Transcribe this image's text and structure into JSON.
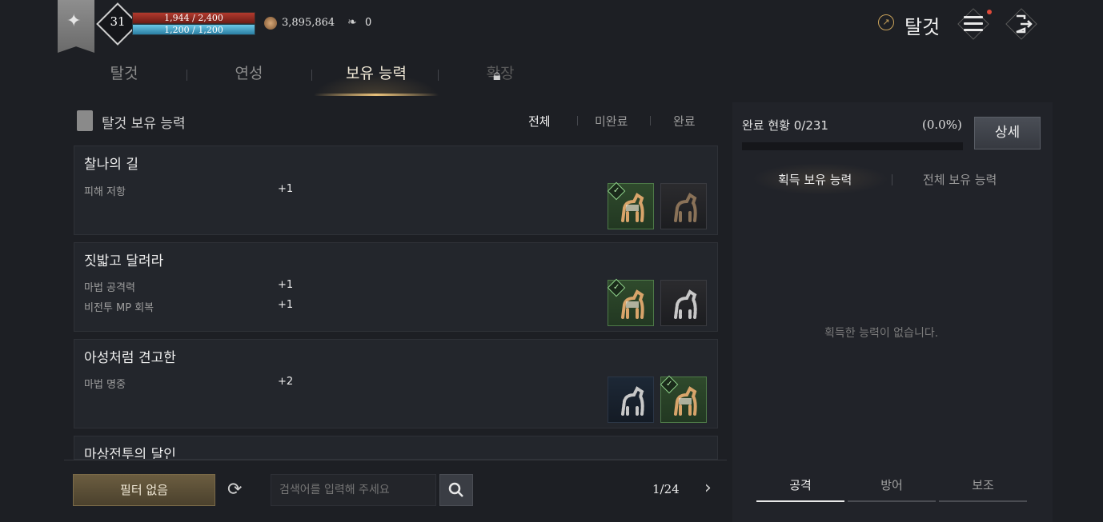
{
  "player": {
    "level": "31",
    "hp": "1,944 / 2,400",
    "hp_fraction": 0.81,
    "mp": "1,200 / 1,200",
    "mp_fraction": 1.0,
    "gold": "3,895,864",
    "wings": "0"
  },
  "header": {
    "title": "탈것",
    "title_icon": "external-link-icon",
    "menu_icon": "hamburger-menu-icon",
    "exit_icon": "exit-icon"
  },
  "tabs": [
    {
      "label": "탈것",
      "active": false
    },
    {
      "label": "연성",
      "active": false
    },
    {
      "label": "보유 능력",
      "active": true
    },
    {
      "label": "확장",
      "active": false,
      "locked": true
    }
  ],
  "section": {
    "title": "탈것 보유 능력",
    "filters": [
      "전체",
      "미완료",
      "완료"
    ],
    "active_filter": "전체"
  },
  "cards": [
    {
      "title": "찰나의 길",
      "stats": [
        {
          "name": "피해 저항",
          "value": "+1"
        }
      ],
      "mounts": [
        {
          "style": "green",
          "owned": true,
          "icon": "tan-horse-icon"
        },
        {
          "style": "dark",
          "owned": false,
          "icon": "brown-horse-icon"
        }
      ]
    },
    {
      "title": "짓밟고 달려라",
      "stats": [
        {
          "name": "마법 공격력",
          "value": "+1"
        },
        {
          "name": "비전투 MP 회복",
          "value": "+1"
        }
      ],
      "mounts": [
        {
          "style": "green",
          "owned": true,
          "icon": "tan-horse-icon"
        },
        {
          "style": "dark",
          "owned": false,
          "icon": "zebra-icon"
        }
      ]
    },
    {
      "title": "아성처럼 견고한",
      "stats": [
        {
          "name": "마법 명중",
          "value": "+2"
        }
      ],
      "mounts": [
        {
          "style": "navy",
          "owned": false,
          "icon": "zebra-icon"
        },
        {
          "style": "green",
          "owned": true,
          "icon": "tan-horse-icon"
        }
      ]
    },
    {
      "title": "마상전투의 달인",
      "stats": [],
      "mounts": []
    }
  ],
  "bottom": {
    "filter_button": "필터 없음",
    "search_placeholder": "검색어를 입력해 주세요",
    "page": "1/24"
  },
  "right_panel": {
    "progress_label": "완료 현황 0/231",
    "progress_percent": "(0.0%)",
    "progress_fraction": 0.0,
    "detail_button": "상세",
    "tabs": [
      "획득 보유 능력",
      "전체 보유 능력"
    ],
    "active_tab": "획득 보유 능력",
    "empty_message": "획득한 능력이 없습니다.",
    "bottom_tabs": [
      "공격",
      "방어",
      "보조"
    ],
    "active_bottom_tab": "공격"
  },
  "colors": {
    "background": "#1d1f24",
    "accent_gold": "#e8c07a",
    "owned_green": "#4e7a48",
    "hp_red": "#b23a2e",
    "mp_blue": "#6cc7e6"
  }
}
